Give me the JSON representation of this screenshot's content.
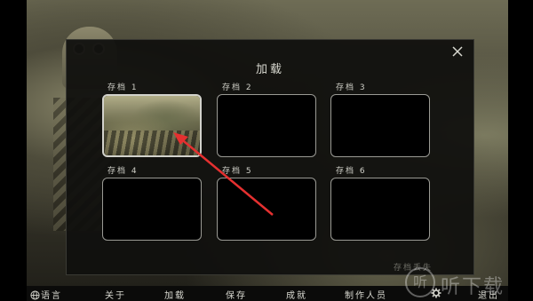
{
  "dialog": {
    "title": "加载",
    "save_lost_text": "存档丢失"
  },
  "slots": [
    {
      "label": "存档 1",
      "has_thumbnail": true,
      "selected": true
    },
    {
      "label": "存档 2",
      "has_thumbnail": false
    },
    {
      "label": "存档 3",
      "has_thumbnail": false
    },
    {
      "label": "存档 4",
      "has_thumbnail": false
    },
    {
      "label": "存档 5",
      "has_thumbnail": false
    },
    {
      "label": "存档 6",
      "has_thumbnail": false
    }
  ],
  "bottom_menu": {
    "language": "语言",
    "about": "关于",
    "load": "加载",
    "save": "保存",
    "achievements": "成就",
    "credits": "制作人员",
    "exit": "退出"
  },
  "icons": {
    "close": "close-icon",
    "language": "globe-icon",
    "settings": "gear-icon"
  },
  "colors": {
    "annotation_arrow": "#e53030",
    "dialog_bg": "#10100e"
  },
  "watermark": {
    "text": "听下载",
    "logo_glyph": "听"
  }
}
